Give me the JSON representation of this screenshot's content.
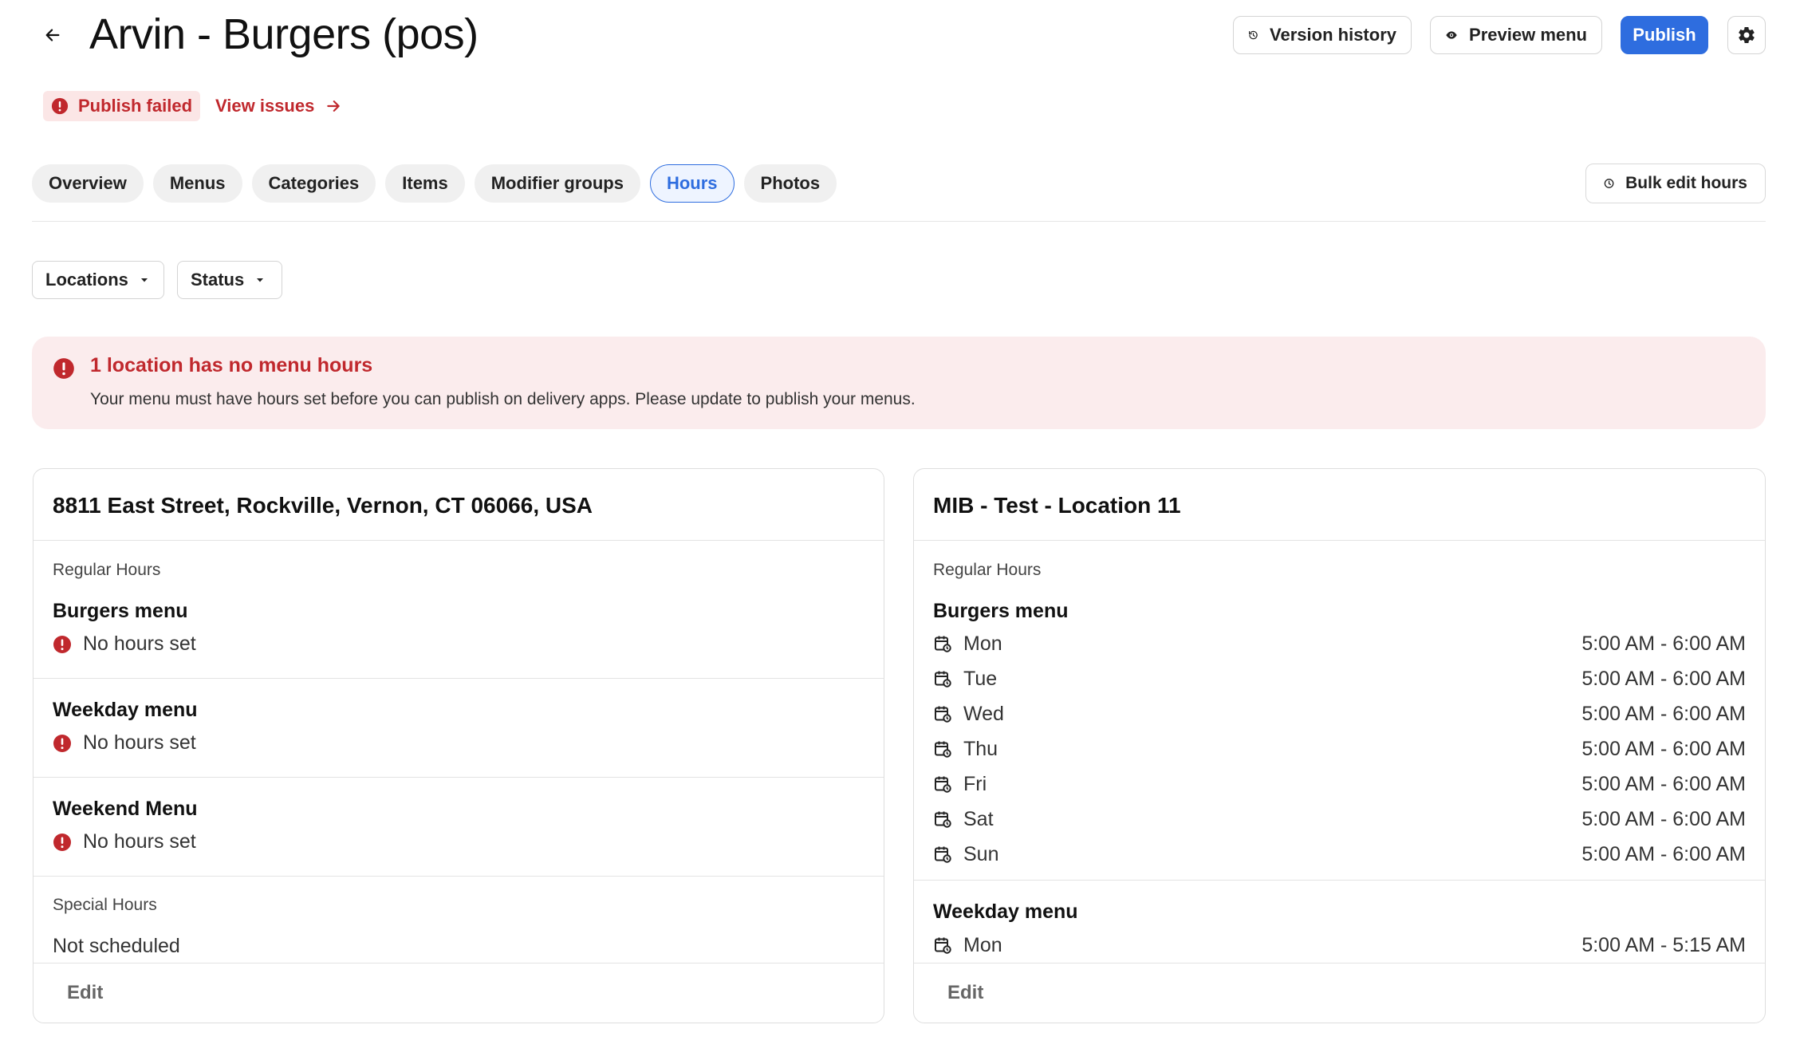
{
  "header": {
    "title": "Arvin - Burgers (pos)",
    "version_history": "Version history",
    "preview_menu": "Preview menu",
    "publish": "Publish"
  },
  "status": {
    "badge": "Publish failed",
    "view_issues": "View issues"
  },
  "tabs": [
    {
      "label": "Overview"
    },
    {
      "label": "Menus"
    },
    {
      "label": "Categories"
    },
    {
      "label": "Items"
    },
    {
      "label": "Modifier groups"
    },
    {
      "label": "Hours"
    },
    {
      "label": "Photos"
    }
  ],
  "active_tab": "Hours",
  "bulk_edit": "Bulk edit hours",
  "filters": {
    "locations": "Locations",
    "status": "Status"
  },
  "alert": {
    "title": "1 location has no menu hours",
    "text": "Your menu must have hours set before you can publish on delivery apps. Please update to publish your menus."
  },
  "cards": [
    {
      "title": "8811 East Street, Rockville, Vernon, CT 06066, USA",
      "regular_label": "Regular Hours",
      "menus": [
        {
          "name": "Burgers menu",
          "status": "No hours set"
        },
        {
          "name": "Weekday menu",
          "status": "No hours set"
        },
        {
          "name": "Weekend Menu",
          "status": "No hours set"
        }
      ],
      "special_label": "Special Hours",
      "special_value": "Not scheduled",
      "edit": "Edit"
    },
    {
      "title": "MIB - Test - Location 11",
      "regular_label": "Regular Hours",
      "menus": [
        {
          "name": "Burgers menu",
          "days": [
            {
              "day": "Mon",
              "time": "5:00 AM - 6:00 AM"
            },
            {
              "day": "Tue",
              "time": "5:00 AM - 6:00 AM"
            },
            {
              "day": "Wed",
              "time": "5:00 AM - 6:00 AM"
            },
            {
              "day": "Thu",
              "time": "5:00 AM - 6:00 AM"
            },
            {
              "day": "Fri",
              "time": "5:00 AM - 6:00 AM"
            },
            {
              "day": "Sat",
              "time": "5:00 AM - 6:00 AM"
            },
            {
              "day": "Sun",
              "time": "5:00 AM - 6:00 AM"
            }
          ]
        },
        {
          "name": "Weekday menu",
          "days": [
            {
              "day": "Mon",
              "time": "5:00 AM - 5:15 AM"
            }
          ]
        }
      ],
      "edit": "Edit"
    }
  ],
  "colors": {
    "accent": "#2e6ddf",
    "error": "#c0282d",
    "alert_bg": "#fbeced"
  }
}
